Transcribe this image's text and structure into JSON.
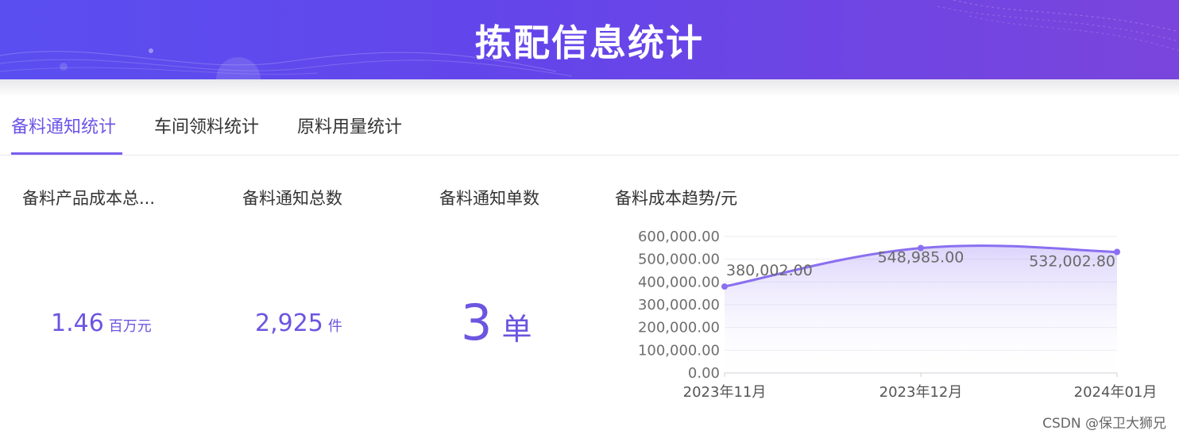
{
  "header": {
    "title": "拣配信息统计"
  },
  "tabs": [
    {
      "label": "备料通知统计",
      "active": true
    },
    {
      "label": "车间领料统计",
      "active": false
    },
    {
      "label": "原料用量统计",
      "active": false
    }
  ],
  "stats": {
    "cost_total": {
      "label": "备料产品成本总...",
      "value": "1.46",
      "unit": "百万元"
    },
    "notice_total": {
      "label": "备料通知总数",
      "value": "2,925",
      "unit": "件"
    },
    "notice_count": {
      "label": "备料通知单数",
      "value": "3",
      "unit": "单"
    }
  },
  "chart_data": {
    "type": "area",
    "title": "备料成本趋势/元",
    "categories": [
      "2023年11月",
      "2023年12月",
      "2024年01月"
    ],
    "values": [
      380002.0,
      548985.0,
      532002.8
    ],
    "data_labels": [
      "380,002.00",
      "548,985.00",
      "532,002.80"
    ],
    "y_ticks": [
      "600,000.00",
      "500,000.00",
      "400,000.00",
      "300,000.00",
      "200,000.00",
      "100,000.00",
      "0.00"
    ],
    "ylim": [
      0,
      600000
    ],
    "grid": true,
    "line_color": "#8a6ff0"
  },
  "watermark": "CSDN @保卫大狮兄"
}
